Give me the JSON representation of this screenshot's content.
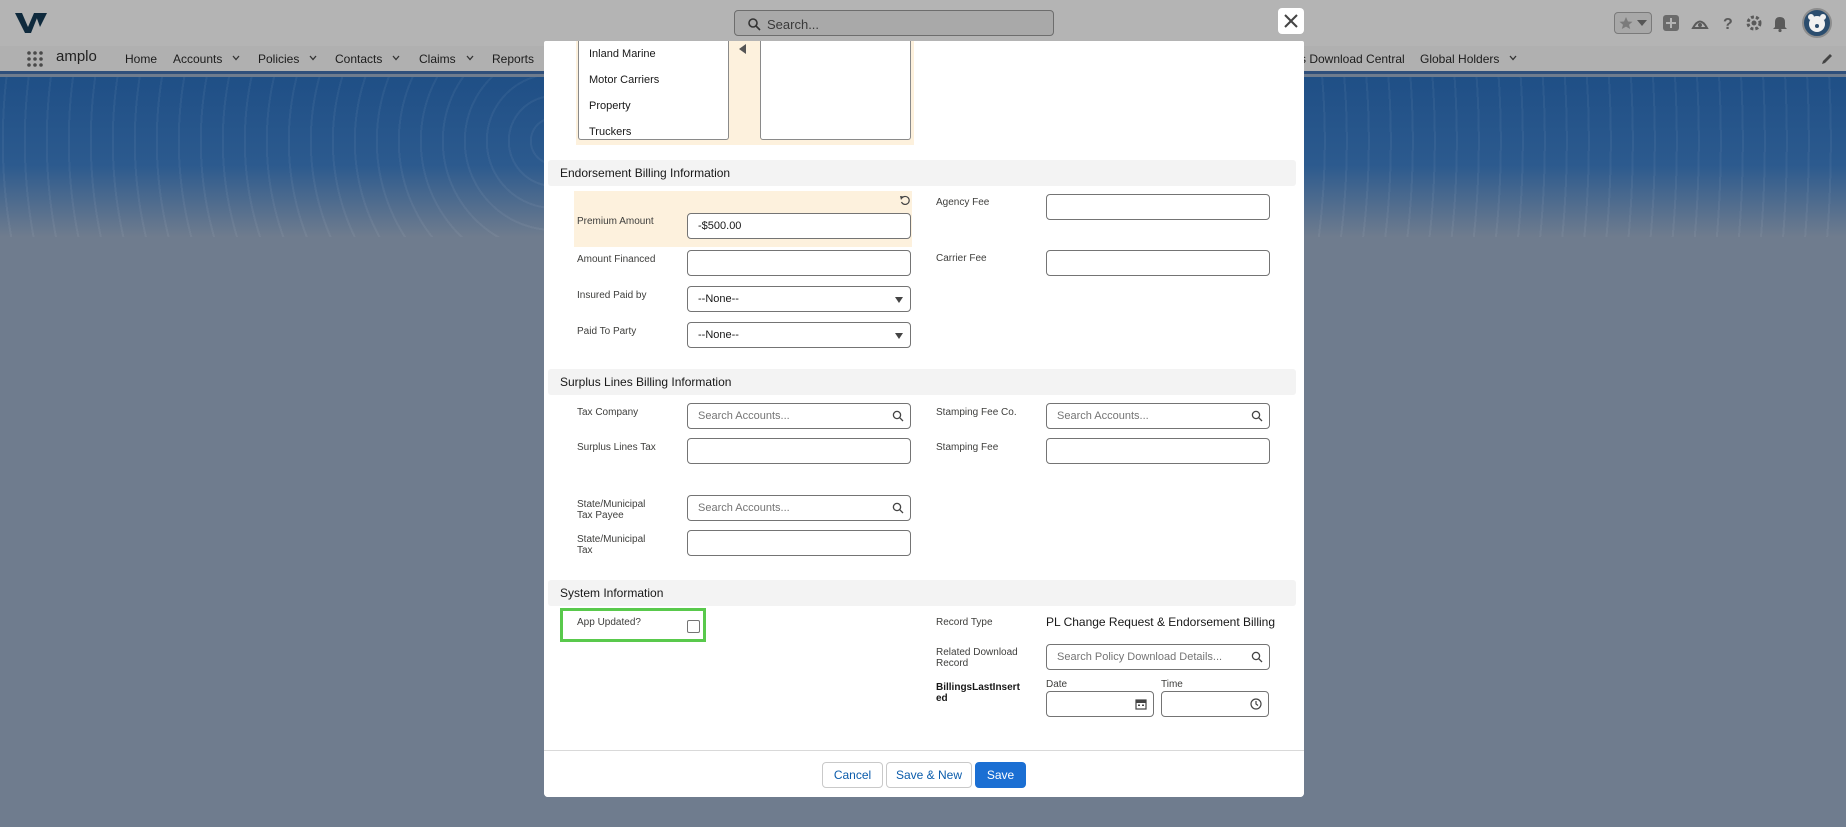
{
  "app": {
    "name": "amplo",
    "search_placeholder": "Search...",
    "nav": [
      {
        "label": "Home"
      },
      {
        "label": "Accounts"
      },
      {
        "label": "Policies"
      },
      {
        "label": "Contacts"
      },
      {
        "label": "Claims"
      },
      {
        "label": "Reports"
      },
      {
        "label": "s Download Central"
      },
      {
        "label": "Global Holders"
      }
    ]
  },
  "modal": {
    "dual_listbox": {
      "available": [
        "Inland Marine",
        "Motor Carriers",
        "Property",
        "Truckers"
      ]
    },
    "sections": {
      "endorsement": "Endorsement Billing Information",
      "surplus": "Surplus Lines Billing Information",
      "system": "System Information"
    },
    "endorsement": {
      "premium_amount_label": "Premium Amount",
      "premium_amount_value": "-$500.00",
      "amount_financed_label": "Amount Financed",
      "insured_paid_by_label": "Insured Paid by",
      "insured_paid_by_value": "--None--",
      "paid_to_party_label": "Paid To Party",
      "paid_to_party_value": "--None--",
      "agency_fee_label": "Agency Fee",
      "carrier_fee_label": "Carrier Fee"
    },
    "surplus": {
      "tax_company_label": "Tax Company",
      "tax_company_placeholder": "Search Accounts...",
      "surplus_lines_tax_label": "Surplus Lines Tax",
      "state_tax_payee_label_1": "State/Municipal",
      "state_tax_payee_label_2": "Tax Payee",
      "state_tax_payee_placeholder": "Search Accounts...",
      "state_tax_label_1": "State/Municipal",
      "state_tax_label_2": "Tax",
      "stamping_fee_co_label": "Stamping Fee Co.",
      "stamping_fee_co_placeholder": "Search Accounts...",
      "stamping_fee_label": "Stamping Fee"
    },
    "system": {
      "app_updated_label": "App Updated?",
      "app_updated_checked": false,
      "record_type_label": "Record Type",
      "record_type_value": "PL Change Request & Endorsement Billing",
      "related_download_label_1": "Related Download",
      "related_download_label_2": "Record",
      "related_download_placeholder": "Search Policy Download Details...",
      "billings_last_label_1": "BillingsLastInsert",
      "billings_last_label_2": "ed",
      "date_label": "Date",
      "time_label": "Time"
    },
    "footer": {
      "cancel": "Cancel",
      "save_new": "Save & New",
      "save": "Save"
    }
  },
  "colors": {
    "brand_button": "#1b6fd3",
    "edited_field_bg": "#fdf1dd",
    "highlight_border": "#59c94c"
  },
  "icons": [
    "search-icon",
    "close-icon",
    "calendar-icon",
    "clock-icon",
    "undo-icon",
    "caret-down-icon",
    "app-launcher-icon",
    "help-icon",
    "gear-icon",
    "bell-icon",
    "plus-icon",
    "star-icon",
    "edit-icon"
  ]
}
